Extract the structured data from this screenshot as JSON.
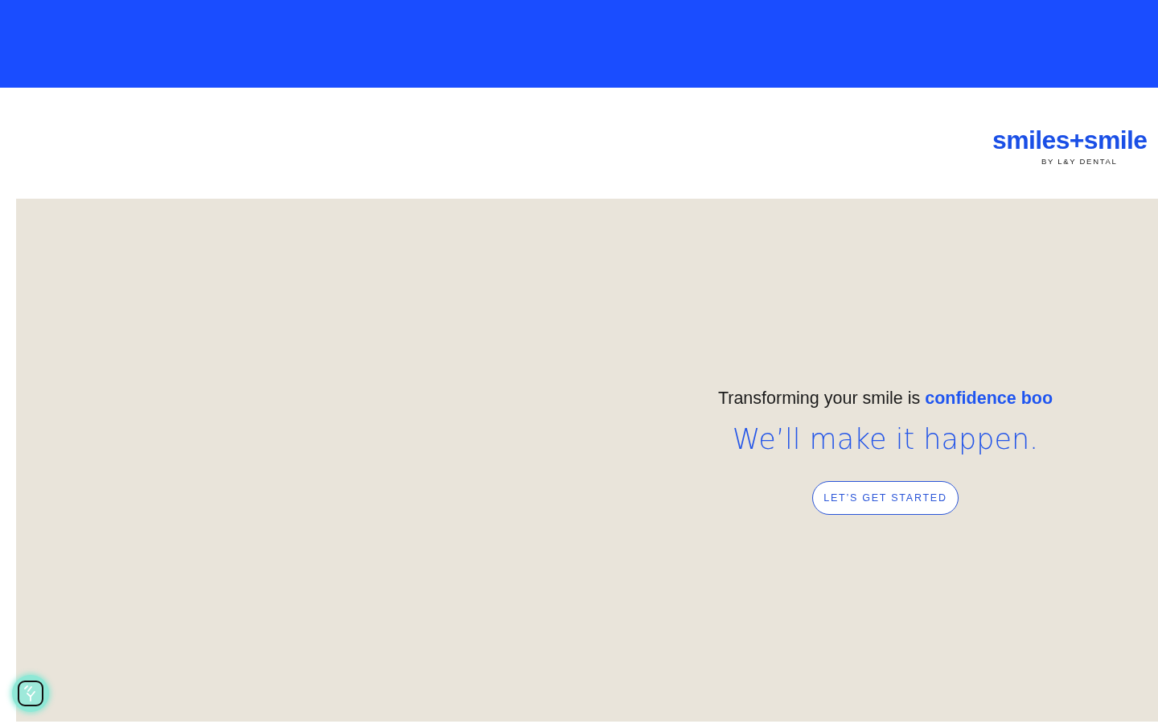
{
  "header": {
    "logo": {
      "wordmark": "smiles+smile",
      "tagline": "BY L&Y DENTAL"
    }
  },
  "hero": {
    "intro": "Transforming your smile is **confidence boo**",
    "headline": "We’ll make it happen.",
    "button": "LET’S GET STARTED"
  }
}
